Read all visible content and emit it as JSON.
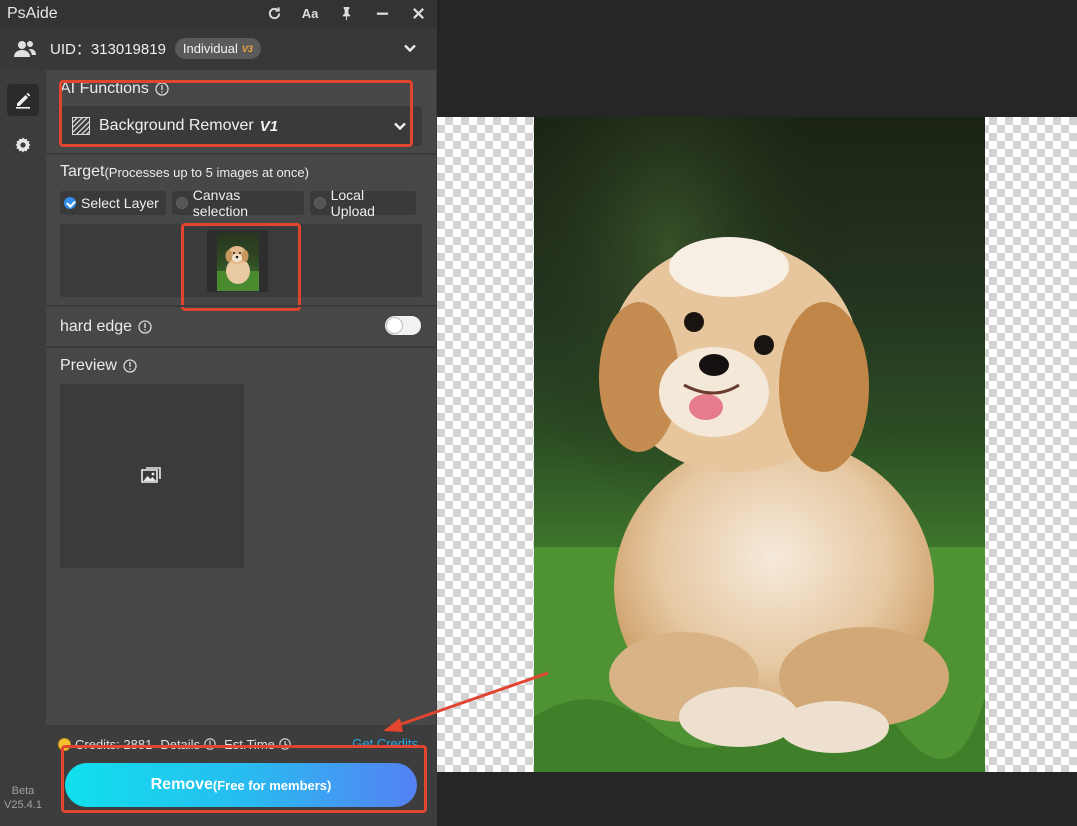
{
  "app": {
    "title": "PsAide",
    "title_actions": [
      "refresh-icon",
      "font-size-icon",
      "pin-icon",
      "minimize-icon",
      "close-icon"
    ],
    "font_button_label": "Aa"
  },
  "user": {
    "uid_text": "UID：313019819",
    "plan": "Individual",
    "plan_tier": "V3"
  },
  "nav": {
    "items": [
      "edit-icon",
      "settings-icon"
    ],
    "beta_label": "Beta",
    "version": "V25.4.1"
  },
  "ai_functions": {
    "title": "AI Functions",
    "selected": "Background Remover",
    "selected_version": "V1"
  },
  "target": {
    "title": "Target",
    "subtitle": "(Processes up to 5 images at once)",
    "options": [
      "Select Layer",
      "Canvas selection",
      "Local Upload"
    ],
    "selected_index": 0
  },
  "hard_edge": {
    "label": "hard edge",
    "enabled": false
  },
  "preview": {
    "title": "Preview"
  },
  "footer": {
    "credits_label": "Credits: 2881",
    "details_label": "Details",
    "est_time_label": "Est.Time",
    "get_credits_label": "Get Credits",
    "remove_label": "Remove",
    "remove_sub_label": "(Free for members)"
  },
  "colors": {
    "accent_blue": "#2f8ef0",
    "highlight_red": "#e2452f",
    "plan_tier": "#f0a23b",
    "link": "#2aa8e6",
    "button_gradient_start": "#10e0ec",
    "button_gradient_end": "#5581f4"
  }
}
